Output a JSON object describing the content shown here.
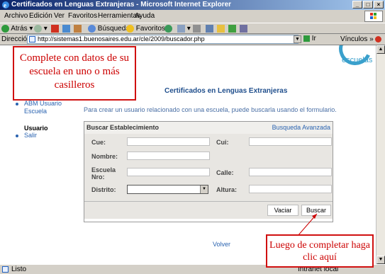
{
  "window": {
    "title": "Certificados en Lenguas Extranjeras - Microsoft Internet Explorer",
    "buttons": {
      "minimize": "_",
      "maximize": "□",
      "close": "×"
    }
  },
  "menu": [
    "Archivo",
    "Edición",
    "Ver",
    "Favoritos",
    "Herramientas",
    "Ayuda"
  ],
  "toolbar": {
    "back": "Atrás",
    "search": "Búsqueda",
    "favorites": "Favoritos"
  },
  "address": {
    "label": "Dirección",
    "url": "http://sistemas1.buenosaires.edu.ar/cle/2009/buscador.php",
    "go": "Ir",
    "links": "Vínculos"
  },
  "logo": {
    "text": "escuelas",
    "color": "#3aa0cc"
  },
  "page": {
    "title": "Certificados en Lenguas Extranjeras",
    "intro": "Para crear un usuario relacionado con una escuela, puede buscarla usando el formulario.",
    "back_link": "Volver"
  },
  "nav": {
    "links": [
      "ABM Usuario",
      "Escuela"
    ],
    "section": "Usuario",
    "logout": "Salir"
  },
  "search": {
    "title": "Buscar Establecimiento",
    "advanced": "Busqueda Avanzada",
    "labels": {
      "cue": "Cue:",
      "cui": "Cui:",
      "nombre": "Nombre:",
      "escuela_nro_1": "Escuela",
      "escuela_nro_2": "Nro:",
      "calle": "Calle:",
      "distrito": "Distrito:",
      "altura": "Altura:"
    },
    "values": {
      "cue": "",
      "cui": "",
      "nombre": "",
      "escuela_nro": "",
      "calle": "",
      "distrito": "",
      "altura": ""
    },
    "clear_button": "Vaciar",
    "search_button": "Buscar"
  },
  "annotations": {
    "top": "Complete con datos de su escuela en uno o más casilleros",
    "bottom": "Luego de completar haga clic aquí",
    "color": "#cc0000"
  },
  "status": {
    "text": "Listo",
    "zone": "Intranet local"
  }
}
